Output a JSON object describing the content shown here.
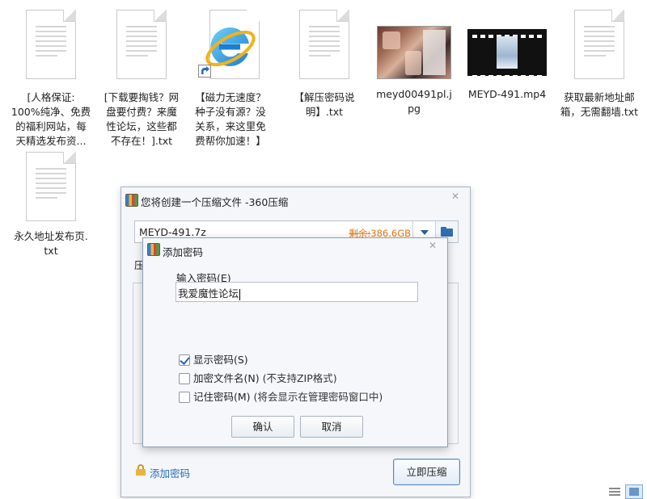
{
  "desktop": {
    "files": [
      {
        "name": "[人格保证:\n100%纯净、免费\n的福利网站，每\n天精选发布资...",
        "icon": "text-file-icon"
      },
      {
        "name": "[下载要掏钱？网\n盘要付费？来魔\n性论坛，这些都\n不存在！].txt",
        "icon": "text-file-icon"
      },
      {
        "name": "【磁力无速度？\n种子没有源？没\n关系，来这里免\n费帮你加速！】",
        "icon": "internet-explorer-shortcut-icon"
      },
      {
        "name": "【解压密码说\n明】.txt",
        "icon": "text-file-icon"
      },
      {
        "name": "meyd00491pl.j\npg",
        "icon": "image-thumbnail"
      },
      {
        "name": "MEYD-491.mp4",
        "icon": "video-thumbnail"
      },
      {
        "name": "获取最新地址邮\n箱，无需翻墙.txt",
        "icon": "text-file-icon"
      },
      {
        "name": "永久地址发布页.\ntxt",
        "icon": "text-file-icon"
      }
    ]
  },
  "compress_dialog": {
    "title": "您将创建一个压缩文件 -360压缩",
    "archive_path": "MEYD-491.7z",
    "free_space_label": "剩余:",
    "free_space_value": "386.6GB",
    "partial_label": "压",
    "add_password_link": "添加密码",
    "compress_now_button": "立即压缩",
    "close_icon": "close-icon"
  },
  "password_dialog": {
    "title": "添加密码",
    "input_label": "输入密码(E)",
    "password_value": "我爱魔性论坛",
    "checkboxes": [
      {
        "label": "显示密码(S)",
        "note": "",
        "checked": true
      },
      {
        "label": "加密文件名(N)",
        "note": " (不支持ZIP格式)",
        "checked": false
      },
      {
        "label": "记住密码(M)",
        "note": " (将会显示在管理密码窗口中)",
        "checked": false
      }
    ],
    "ok_button": "确认",
    "cancel_button": "取消"
  },
  "colors": {
    "accent": "#2a6bb8",
    "free_space": "#e07a17",
    "dialog_bg": "#f4f6f9"
  }
}
